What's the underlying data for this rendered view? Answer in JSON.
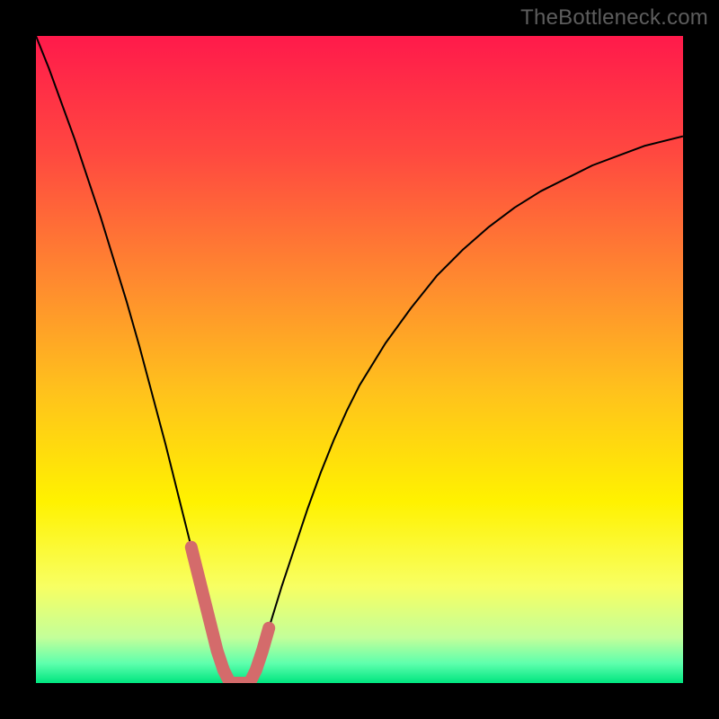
{
  "watermark": "TheBottleneck.com",
  "chart_data": {
    "type": "line",
    "title": "",
    "xlabel": "",
    "ylabel": "",
    "xlim": [
      0,
      100
    ],
    "ylim": [
      0,
      100
    ],
    "grid": false,
    "legend": false,
    "background_gradient": {
      "stops": [
        {
          "offset": 0.0,
          "color": "#ff1a4b"
        },
        {
          "offset": 0.18,
          "color": "#ff4840"
        },
        {
          "offset": 0.38,
          "color": "#ff8a2f"
        },
        {
          "offset": 0.55,
          "color": "#ffc21c"
        },
        {
          "offset": 0.72,
          "color": "#fff200"
        },
        {
          "offset": 0.85,
          "color": "#f8ff62"
        },
        {
          "offset": 0.93,
          "color": "#c3ff9a"
        },
        {
          "offset": 0.97,
          "color": "#5dffad"
        },
        {
          "offset": 1.0,
          "color": "#00e57f"
        }
      ]
    },
    "series": [
      {
        "name": "bottleneck-curve",
        "stroke": "#000000",
        "stroke_width": 2,
        "x": [
          0,
          2,
          4,
          6,
          8,
          10,
          12,
          14,
          16,
          18,
          20,
          21,
          22,
          23,
          24,
          25,
          26,
          27,
          28,
          29,
          30,
          31,
          32,
          33,
          34,
          35,
          36,
          38,
          40,
          42,
          44,
          46,
          48,
          50,
          54,
          58,
          62,
          66,
          70,
          74,
          78,
          82,
          86,
          90,
          94,
          98,
          100
        ],
        "y": [
          100,
          95,
          89.5,
          84,
          78,
          72,
          65.5,
          59,
          52,
          44.5,
          37,
          33,
          29,
          25,
          21,
          17,
          13,
          9,
          5,
          2,
          0,
          0,
          0,
          0,
          2,
          5,
          8.5,
          15,
          21,
          27,
          32.5,
          37.5,
          42,
          46,
          52.5,
          58,
          63,
          67,
          70.5,
          73.5,
          76,
          78,
          80,
          81.5,
          83,
          84,
          84.5
        ]
      },
      {
        "name": "bottleneck-curve-highlight",
        "stroke": "#d46b6b",
        "stroke_width": 14,
        "linecap": "round",
        "x": [
          24,
          25,
          26,
          27,
          28,
          29,
          30,
          31,
          32,
          33,
          34,
          35,
          36
        ],
        "y": [
          21,
          17,
          13,
          9,
          5,
          2,
          0,
          0,
          0,
          0,
          2,
          5,
          8.5
        ]
      }
    ]
  }
}
